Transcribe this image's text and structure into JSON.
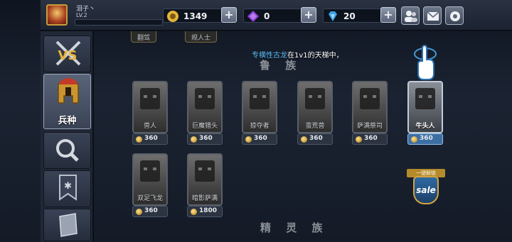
{
  "topbar": {
    "username": "泪子丶",
    "level": "LV.2",
    "xp_progress": 0.0,
    "gold": "1349",
    "gems_purple": "0",
    "gems_blue": "20",
    "colors": {
      "gold": "#e6b43a",
      "purple": "#8e3fd6",
      "blue": "#3da4e8"
    }
  },
  "sidebar": {
    "items": [
      {
        "id": "vs",
        "label": ""
      },
      {
        "id": "units",
        "label": "兵种"
      },
      {
        "id": "search",
        "label": ""
      },
      {
        "id": "banner",
        "label": ""
      },
      {
        "id": "scroll",
        "label": ""
      }
    ]
  },
  "main": {
    "top_tags": [
      "翻驾",
      "规人士"
    ],
    "tip": {
      "highlight": "专横性古龙",
      "rest": "在1v1的天梯中，"
    },
    "section_top_label": "鲁 族",
    "section_bottom_label": "精 灵 族",
    "cards": [
      {
        "name": "兽人",
        "price": "360"
      },
      {
        "name": "巨魔猎头",
        "price": "360"
      },
      {
        "name": "掠夺者",
        "price": "360"
      },
      {
        "name": "蛮荒兽",
        "price": "360"
      },
      {
        "name": "萨满祭司",
        "price": "360"
      },
      {
        "name": "牛头人",
        "price": "360"
      },
      {
        "name": "双足飞龙",
        "price": "360"
      },
      {
        "name": "暗影萨满",
        "price": "1800"
      }
    ],
    "selected_card": "牛头人",
    "sale": {
      "ribbon": "一键解锁",
      "label": "sale"
    }
  }
}
